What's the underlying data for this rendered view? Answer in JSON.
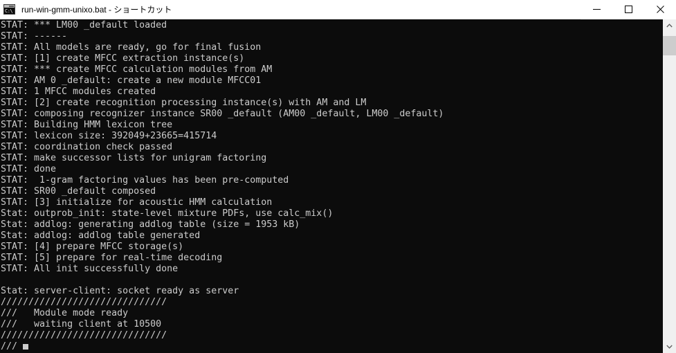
{
  "window": {
    "title": "run-win-gmm-unixo.bat - ショートカット",
    "icon": "cmd-console-icon",
    "icon_prompt_text": "C:\\",
    "colors": {
      "titlebar_bg": "#ffffff",
      "titlebar_text": "#000000",
      "console_bg": "#0c0c0c",
      "console_text": "#cccccc",
      "scrollbar_track": "#f0f0f0",
      "scrollbar_thumb": "#cdcdcd"
    },
    "controls": {
      "minimize_label": "Minimize",
      "maximize_label": "Maximize",
      "close_label": "Close"
    }
  },
  "scrollbar": {
    "up_arrow_label": "Scroll up",
    "down_arrow_label": "Scroll down",
    "thumb_label": "Scroll thumb"
  },
  "console": {
    "lines": [
      "STAT: *** LM00 _default loaded",
      "STAT: ------",
      "STAT: All models are ready, go for final fusion",
      "STAT: [1] create MFCC extraction instance(s)",
      "STAT: *** create MFCC calculation modules from AM",
      "STAT: AM 0 _default: create a new module MFCC01",
      "STAT: 1 MFCC modules created",
      "STAT: [2] create recognition processing instance(s) with AM and LM",
      "STAT: composing recognizer instance SR00 _default (AM00 _default, LM00 _default)",
      "STAT: Building HMM lexicon tree",
      "STAT: lexicon size: 392049+23665=415714",
      "STAT: coordination check passed",
      "STAT: make successor lists for unigram factoring",
      "STAT: done",
      "STAT:  1-gram factoring values has been pre-computed",
      "STAT: SR00 _default composed",
      "STAT: [3] initialize for acoustic HMM calculation",
      "Stat: outprob_init: state-level mixture PDFs, use calc_mix()",
      "Stat: addlog: generating addlog table (size = 1953 kB)",
      "Stat: addlog: addlog table generated",
      "STAT: [4] prepare MFCC storage(s)",
      "STAT: [5] prepare for real-time decoding",
      "STAT: All init successfully done",
      "",
      "Stat: server-client: socket ready as server",
      "//////////////////////////////",
      "///   Module mode ready",
      "///   waiting client at 10500",
      "//////////////////////////////",
      "///"
    ],
    "cursor_visible": true
  }
}
